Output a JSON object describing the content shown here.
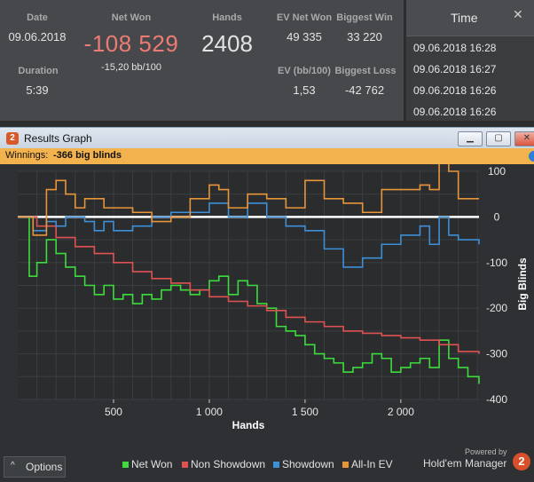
{
  "stats": {
    "date_label": "Date",
    "date_value": "09.06.2018",
    "duration_label": "Duration",
    "duration_value": "5:39",
    "netwon_label": "Net Won",
    "netwon_value": "-108 529",
    "netwon_bb": "-15,20 bb/100",
    "hands_label": "Hands",
    "hands_value": "2408",
    "ev_label": "EV Net Won",
    "ev_value": "49 335",
    "evbb_label": "EV (bb/100)",
    "evbb_value": "1,53",
    "bigwin_label": "Biggest Win",
    "bigwin_value": "33 220",
    "bigloss_label": "Biggest Loss",
    "bigloss_value": "-42 762"
  },
  "time_panel": {
    "header": "Time",
    "rows": [
      "09.06.2018 16:28",
      "09.06.2018 16:27",
      "09.06.2018 16:26",
      "09.06.2018 16:26"
    ]
  },
  "window": {
    "title": "Results Graph",
    "icon_glyph": "2",
    "winnings_label": "Winnings:",
    "winnings_value": "-366 big blinds",
    "options_label": "Options",
    "options_glyph": "^",
    "powered_by": "Powered by",
    "brand": "Hold'em Manager",
    "brand_glyph": "2"
  },
  "colors": {
    "net_won": "#3ddc3d",
    "non_showdown": "#e05252",
    "showdown": "#3d8fd8",
    "allin_ev": "#e8953a",
    "background": "#2b2d2f"
  },
  "chart_data": {
    "type": "line",
    "xlabel": "Hands",
    "ylabel": "Big Blinds",
    "xlim": [
      0,
      2408
    ],
    "ylim": [
      -400,
      100
    ],
    "xticks": [
      500,
      1000,
      1500,
      2000
    ],
    "xtick_labels": [
      "500",
      "1 000",
      "1 500",
      "2 000"
    ],
    "yticks": [
      100,
      0,
      -100,
      -200,
      -300,
      -400
    ],
    "ytick_labels": [
      "100",
      "0",
      "-100",
      "-200",
      "-300",
      "-400"
    ],
    "grid": true,
    "legend": "bottom",
    "series": [
      {
        "name": "Net Won",
        "x": [
          0,
          60,
          100,
          150,
          200,
          250,
          300,
          350,
          400,
          450,
          500,
          550,
          600,
          650,
          700,
          750,
          800,
          850,
          900,
          950,
          1000,
          1050,
          1100,
          1150,
          1200,
          1250,
          1300,
          1350,
          1400,
          1450,
          1500,
          1550,
          1600,
          1650,
          1700,
          1750,
          1800,
          1850,
          1900,
          1950,
          2000,
          2050,
          2100,
          2150,
          2200,
          2250,
          2300,
          2350,
          2408
        ],
        "values": [
          0,
          -130,
          -100,
          -50,
          -80,
          -110,
          -130,
          -150,
          -170,
          -150,
          -180,
          -170,
          -190,
          -170,
          -180,
          -160,
          -150,
          -160,
          -170,
          -160,
          -140,
          -130,
          -170,
          -140,
          -150,
          -190,
          -200,
          -240,
          -250,
          -260,
          -280,
          -300,
          -310,
          -320,
          -340,
          -330,
          -320,
          -300,
          -310,
          -340,
          -330,
          -320,
          -310,
          -330,
          -270,
          -310,
          -330,
          -350,
          -366
        ]
      },
      {
        "name": "Non Showdown",
        "x": [
          0,
          100,
          200,
          300,
          400,
          500,
          600,
          700,
          800,
          900,
          1000,
          1100,
          1200,
          1300,
          1400,
          1500,
          1600,
          1700,
          1800,
          1900,
          2000,
          2100,
          2200,
          2300,
          2408
        ],
        "values": [
          0,
          -20,
          -45,
          -65,
          -80,
          -100,
          -120,
          -135,
          -145,
          -160,
          -175,
          -185,
          -195,
          -205,
          -220,
          -230,
          -240,
          -250,
          -255,
          -260,
          -265,
          -270,
          -280,
          -295,
          -300
        ]
      },
      {
        "name": "Showdown",
        "x": [
          0,
          80,
          150,
          200,
          250,
          300,
          350,
          400,
          450,
          500,
          550,
          600,
          700,
          800,
          900,
          1000,
          1100,
          1200,
          1300,
          1400,
          1500,
          1600,
          1700,
          1800,
          1900,
          2000,
          2100,
          2150,
          2200,
          2250,
          2300,
          2408
        ],
        "values": [
          0,
          -30,
          -10,
          -20,
          0,
          0,
          -10,
          -30,
          -10,
          -30,
          -30,
          -20,
          0,
          10,
          10,
          30,
          0,
          30,
          0,
          -20,
          -30,
          -70,
          -110,
          -90,
          -60,
          -40,
          -20,
          -60,
          0,
          -40,
          -50,
          -60
        ]
      },
      {
        "name": "All-In EV",
        "x": [
          0,
          80,
          150,
          200,
          250,
          300,
          350,
          400,
          450,
          500,
          600,
          700,
          800,
          900,
          1000,
          1050,
          1100,
          1200,
          1300,
          1400,
          1500,
          1600,
          1700,
          1800,
          1900,
          2000,
          2100,
          2150,
          2200,
          2250,
          2300,
          2408
        ],
        "values": [
          0,
          -40,
          60,
          80,
          50,
          20,
          40,
          40,
          20,
          20,
          10,
          -10,
          0,
          40,
          70,
          60,
          20,
          50,
          40,
          20,
          80,
          40,
          30,
          10,
          60,
          60,
          70,
          60,
          120,
          100,
          40,
          40
        ]
      }
    ]
  }
}
